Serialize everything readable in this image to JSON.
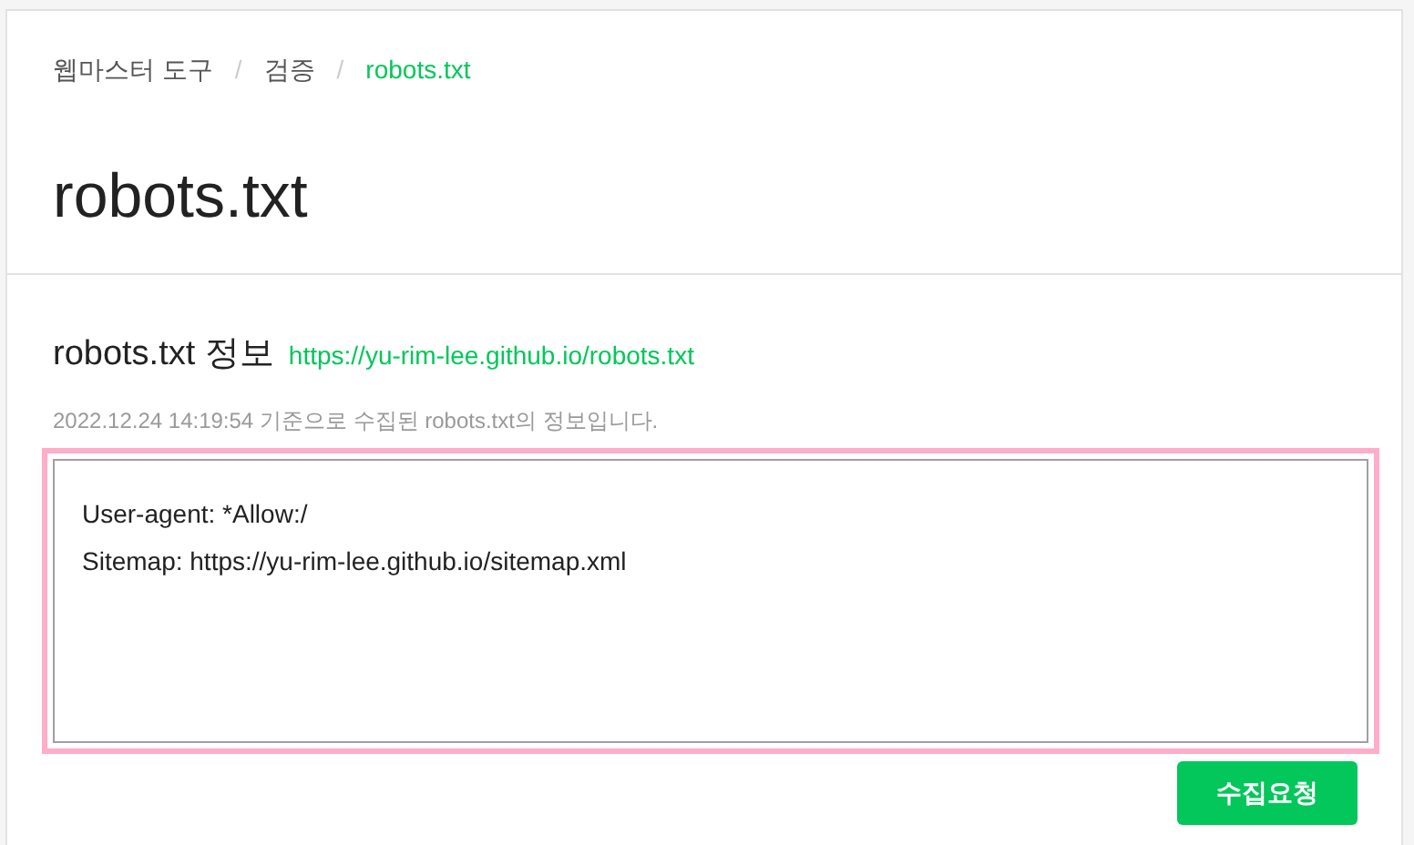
{
  "breadcrumb": [
    {
      "label": "웹마스터 도구",
      "selected": false
    },
    {
      "label": "검증",
      "selected": false
    },
    {
      "label": "robots.txt",
      "selected": true
    }
  ],
  "breadcrumb_separator": "/",
  "title": "robots.txt",
  "section": {
    "heading": "robots.txt 정보",
    "link": "https://yu-rim-lee.github.io/robots.txt",
    "note": "2022.12.24 14:19:54 기준으로 수집된 robots.txt의 정보입니다.",
    "content_lines": [
      "User-agent: *Allow:/",
      "Sitemap: https://yu-rim-lee.github.io/sitemap.xml"
    ]
  },
  "button": "수집요청"
}
